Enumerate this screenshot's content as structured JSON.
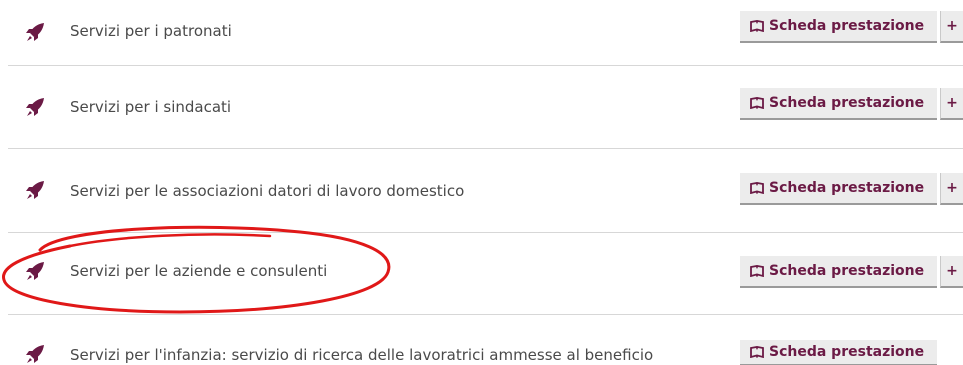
{
  "colors": {
    "accent": "#6b1a45",
    "button_bg": "#ececec",
    "text": "#4a4a4a",
    "divider": "#d7d7d7",
    "annotation": "#e01818"
  },
  "rows": [
    {
      "label": "Servizi per i patronati",
      "icon": "rocket-icon",
      "button_label": "Scheda prestazione",
      "button_icon": "open-book-icon",
      "expand_label": "+"
    },
    {
      "label": "Servizi per i sindacati",
      "icon": "rocket-icon",
      "button_label": "Scheda prestazione",
      "button_icon": "open-book-icon",
      "expand_label": "+"
    },
    {
      "label": "Servizi per le associazioni datori di lavoro domestico",
      "icon": "rocket-icon",
      "button_label": "Scheda prestazione",
      "button_icon": "open-book-icon",
      "expand_label": "+"
    },
    {
      "label": "Servizi per le aziende e consulenti",
      "icon": "rocket-icon",
      "button_label": "Scheda prestazione",
      "button_icon": "open-book-icon",
      "expand_label": "+",
      "highlighted": true
    },
    {
      "label": "Servizi per l'infanzia: servizio di ricerca delle lavoratrici ammesse al beneficio",
      "icon": "rocket-icon",
      "button_label": "Scheda prestazione",
      "button_icon": "open-book-icon"
    }
  ],
  "annotation": {
    "type": "hand-drawn-ellipse",
    "target_row": 3
  }
}
